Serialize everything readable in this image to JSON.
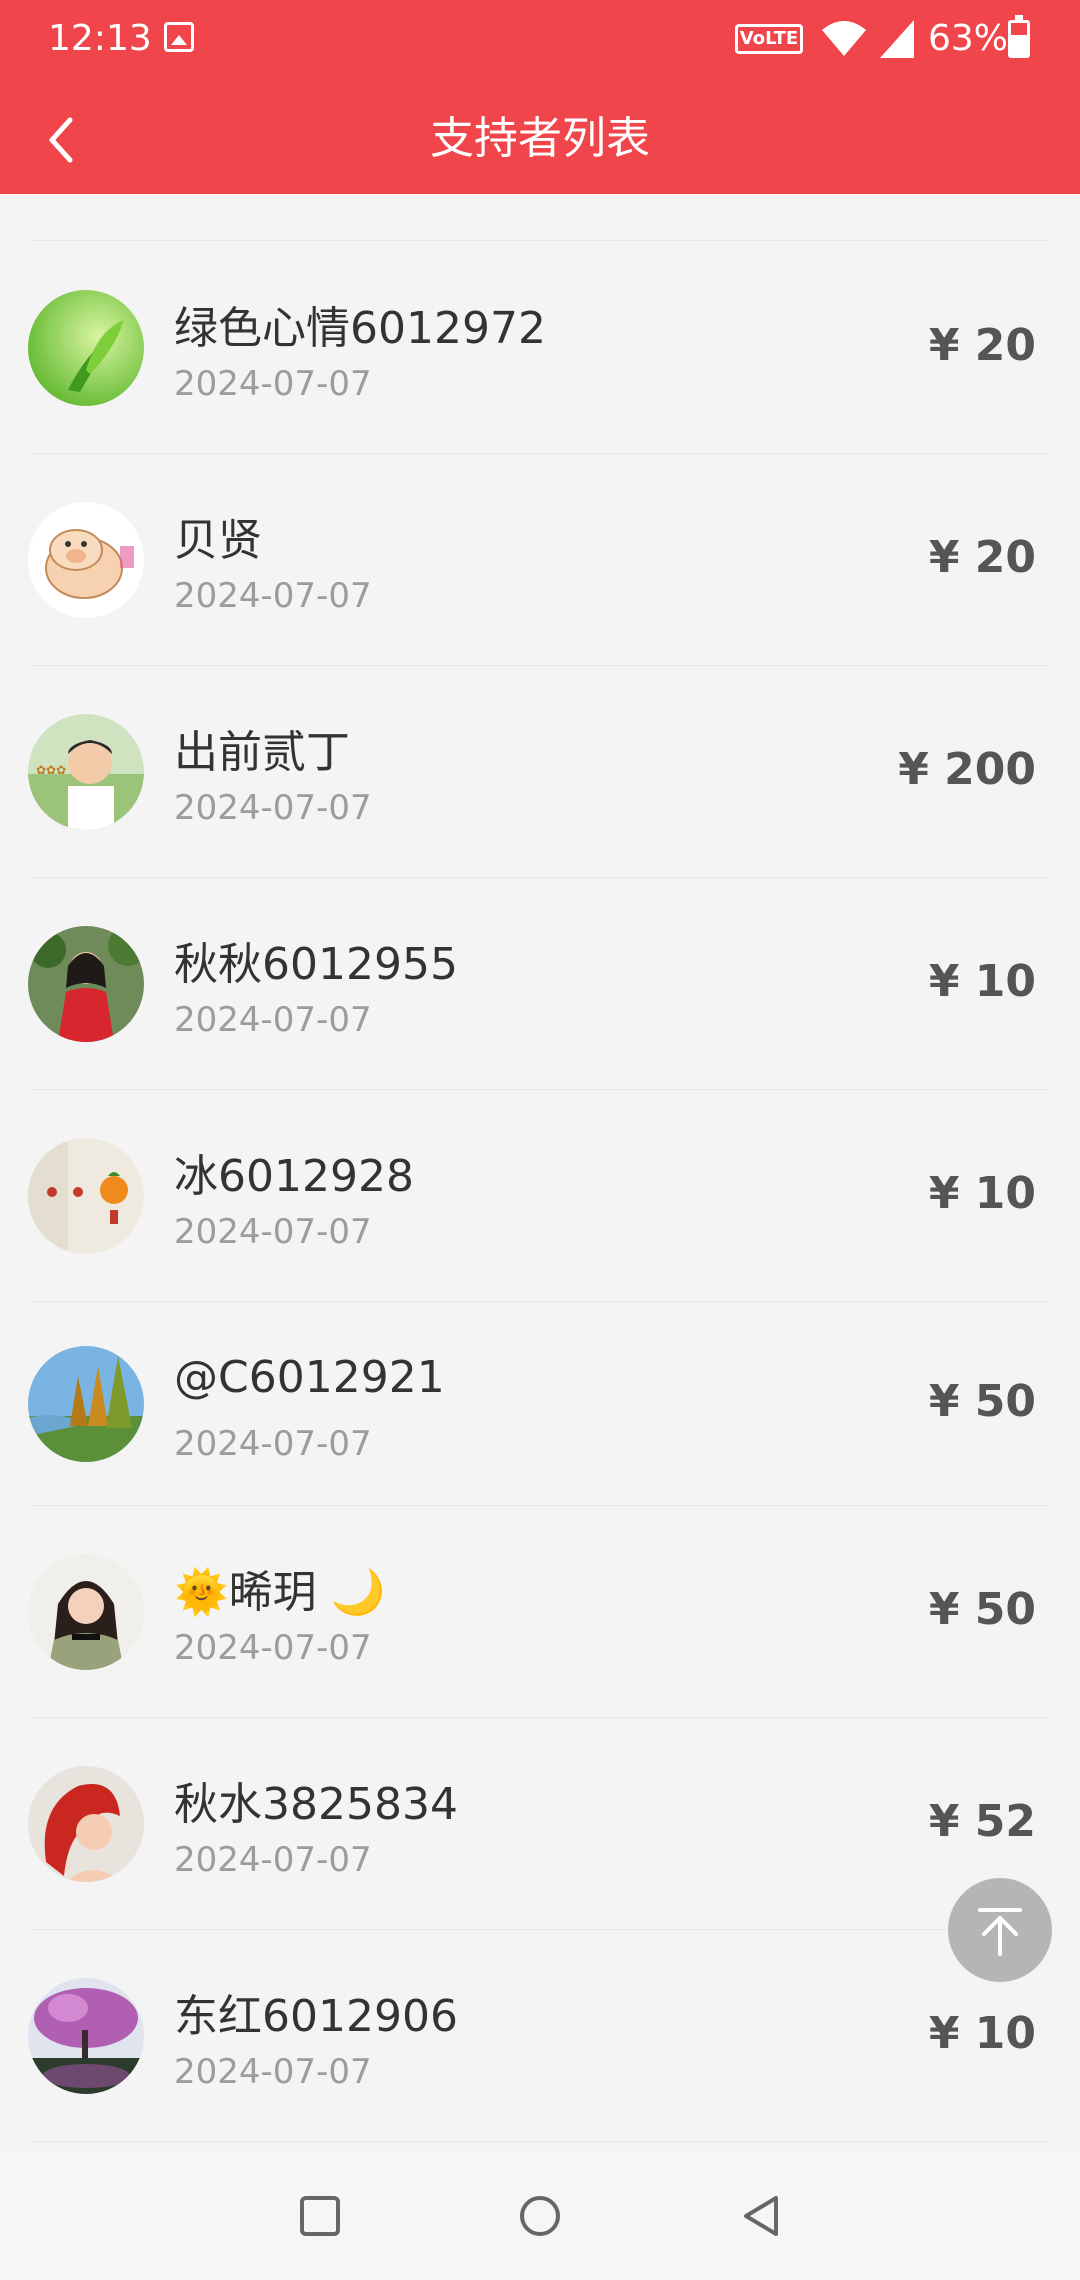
{
  "status_bar": {
    "time": "12:13",
    "volte": "VoLTE",
    "battery": "63%"
  },
  "header": {
    "title": "支持者列表"
  },
  "supporters": [
    {
      "name": "绿色心情6012972",
      "date": "2024-07-07",
      "amount": "¥ 20",
      "avatar": "green-leaf"
    },
    {
      "name": "贝贤",
      "date": "2024-07-07",
      "amount": "¥ 20",
      "avatar": "cartoon-pig"
    },
    {
      "name": "出前贰丁",
      "date": "2024-07-07",
      "amount": "¥ 200",
      "avatar": "child-photo"
    },
    {
      "name": "秋秋6012955",
      "date": "2024-07-07",
      "amount": "¥ 10",
      "avatar": "woman-red-coat"
    },
    {
      "name": "冰6012928",
      "date": "2024-07-07",
      "amount": "¥ 10",
      "avatar": "orange-fruit"
    },
    {
      "name": "@C6012921",
      "date": "2024-07-07",
      "amount": "¥ 50",
      "avatar": "lake-trees"
    },
    {
      "name": "🌞晞玥 🌙",
      "date": "2024-07-07",
      "amount": "¥ 50",
      "avatar": "woman-portrait"
    },
    {
      "name": "秋水3825834",
      "date": "2024-07-07",
      "amount": "¥ 52",
      "avatar": "cartoon-mermaid"
    },
    {
      "name": "东红6012906",
      "date": "2024-07-07",
      "amount": "¥ 10",
      "avatar": "purple-tree"
    }
  ],
  "colors": {
    "header": "#f0464b",
    "amount": "#555555",
    "date": "#9c9c9c"
  }
}
